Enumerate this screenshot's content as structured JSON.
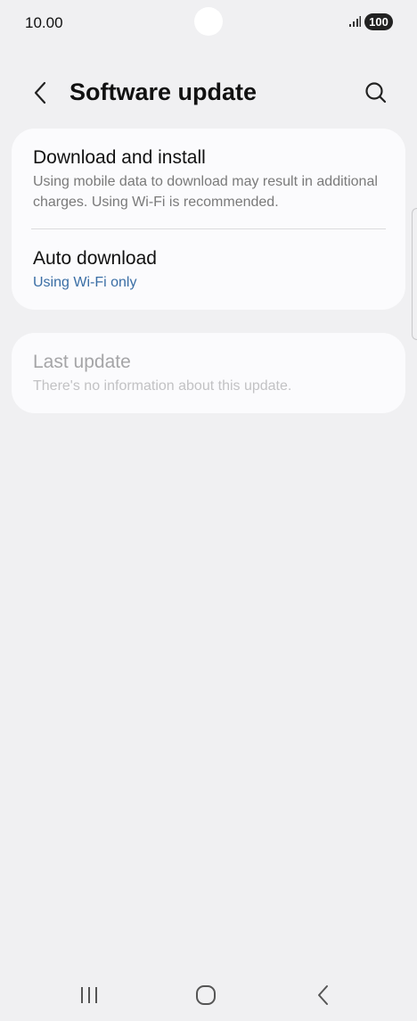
{
  "status_bar": {
    "time": "10.00",
    "battery": "100"
  },
  "header": {
    "title": "Software update"
  },
  "items": {
    "download_install": {
      "title": "Download and install",
      "subtitle": "Using mobile data to download may result in additional charges. Using Wi-Fi is recommended."
    },
    "auto_download": {
      "title": "Auto download",
      "subtitle": "Using Wi-Fi only"
    },
    "last_update": {
      "title": "Last update",
      "subtitle": "There's no information about this update."
    }
  },
  "icons": {
    "back": "chevron-left-icon",
    "search": "search-icon",
    "signal": "signal-icon",
    "nav_recents": "recents-icon",
    "nav_home": "home-icon",
    "nav_back": "back-icon"
  },
  "colors": {
    "background": "#f0f0f2",
    "card": "#fbfbfd",
    "accent_link": "#3a6ea5",
    "disabled_text": "#a5a5a7"
  }
}
